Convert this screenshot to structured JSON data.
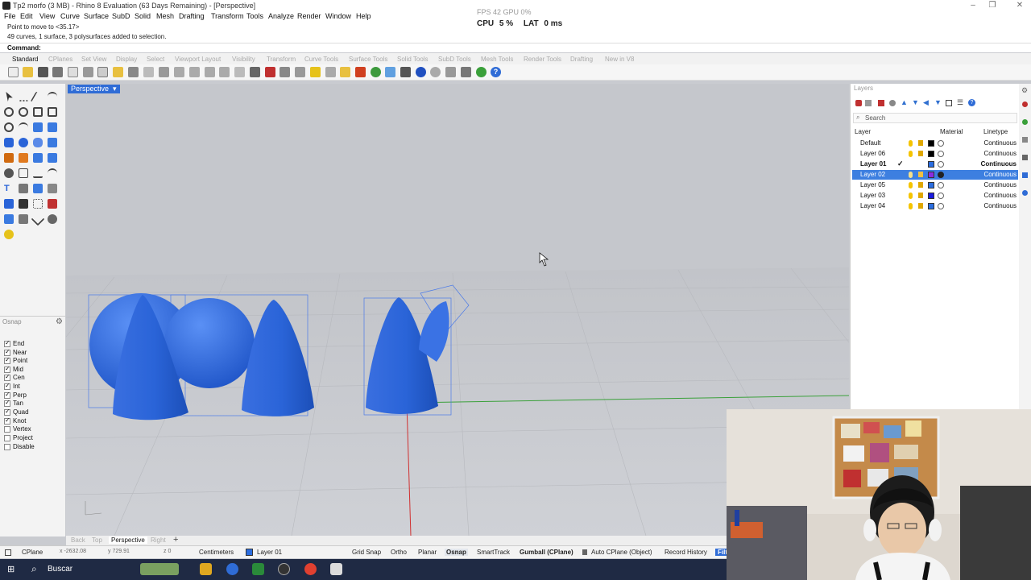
{
  "window": {
    "title": "Tp2 morfo (3 MB) - Rhino 8 Evaluation (63 Days Remaining) - [Perspective]"
  },
  "menu": [
    "File",
    "Edit",
    "View",
    "Curve",
    "Surface",
    "SubD",
    "Solid",
    "Mesh",
    "Drafting",
    "Transform",
    "Tools",
    "Analyze",
    "Render",
    "Window",
    "Help"
  ],
  "perf": {
    "cpu_label": "CPU",
    "cpu_value": "5 %",
    "lat_label": "LAT",
    "lat_value": "0 ms",
    "fps_hint": "FPS 42   GPU 0%"
  },
  "history": [
    "Point to move to <35.17>",
    "49 curves, 1 surface, 3 polysurfaces added to selection."
  ],
  "command": {
    "label": "Command:"
  },
  "toolbar_tabs": [
    "Standard",
    "CPlanes",
    "Set View",
    "Display",
    "Select",
    "Viewport Layout",
    "Visibility",
    "Transform",
    "Curve Tools",
    "Surface Tools",
    "Solid Tools",
    "SubD Tools",
    "Mesh Tools",
    "Render Tools",
    "Drafting",
    "New in V8"
  ],
  "viewport": {
    "active_name": "Perspective",
    "tabs": [
      "Back",
      "Top",
      "Perspective",
      "Right"
    ],
    "active_tab": "Perspective"
  },
  "osnap": {
    "title": "Osnap",
    "items": [
      {
        "label": "End",
        "checked": true
      },
      {
        "label": "Near",
        "checked": true
      },
      {
        "label": "Point",
        "checked": true
      },
      {
        "label": "Mid",
        "checked": true
      },
      {
        "label": "Cen",
        "checked": true
      },
      {
        "label": "Int",
        "checked": true
      },
      {
        "label": "Perp",
        "checked": true
      },
      {
        "label": "Tan",
        "checked": true
      },
      {
        "label": "Quad",
        "checked": true
      },
      {
        "label": "Knot",
        "checked": true
      },
      {
        "label": "Vertex",
        "checked": false
      },
      {
        "label": "Project",
        "checked": false
      },
      {
        "label": "Disable",
        "checked": false
      }
    ]
  },
  "layers": {
    "panel_title": "Layers",
    "search_placeholder": "Search",
    "columns": {
      "layer": "Layer",
      "material": "Material",
      "linetype": "Linetype"
    },
    "rows": [
      {
        "name": "Default",
        "color": "#000000",
        "linetype": "Continuous",
        "current": false,
        "selected": false
      },
      {
        "name": "Layer 06",
        "color": "#000000",
        "linetype": "Continuous",
        "current": false,
        "selected": false
      },
      {
        "name": "Layer 01",
        "color": "#2b6de0",
        "linetype": "Continuous",
        "current": true,
        "selected": false
      },
      {
        "name": "Layer 02",
        "color": "#8a2be2",
        "linetype": "Continuous",
        "current": false,
        "selected": true
      },
      {
        "name": "Layer 05",
        "color": "#2b6de0",
        "linetype": "Continuous",
        "current": false,
        "selected": false
      },
      {
        "name": "Layer 03",
        "color": "#1a1ae0",
        "linetype": "Continuous",
        "current": false,
        "selected": false
      },
      {
        "name": "Layer 04",
        "color": "#2b6de0",
        "linetype": "Continuous",
        "current": false,
        "selected": false
      }
    ]
  },
  "status": {
    "cplane": "CPlane",
    "x": "x -2632.08",
    "y": "y 729.91",
    "z": "z 0",
    "units": "Centimeters",
    "layer": "Layer 01",
    "grid_snap": "Grid Snap",
    "ortho": "Ortho",
    "planar": "Planar",
    "osnap": "Osnap",
    "smarttrack": "SmartTrack",
    "gumball": "Gumball (CPlane)",
    "auto_cplane": "Auto CPlane (Object)",
    "record_history": "Record History",
    "filter": "Filt"
  },
  "taskbar": {
    "search_label": "Buscar"
  },
  "colors": {
    "accent": "#2f6cd6",
    "object_blue": "#2a64d8",
    "viewport_bg": "#c5c7cc"
  }
}
